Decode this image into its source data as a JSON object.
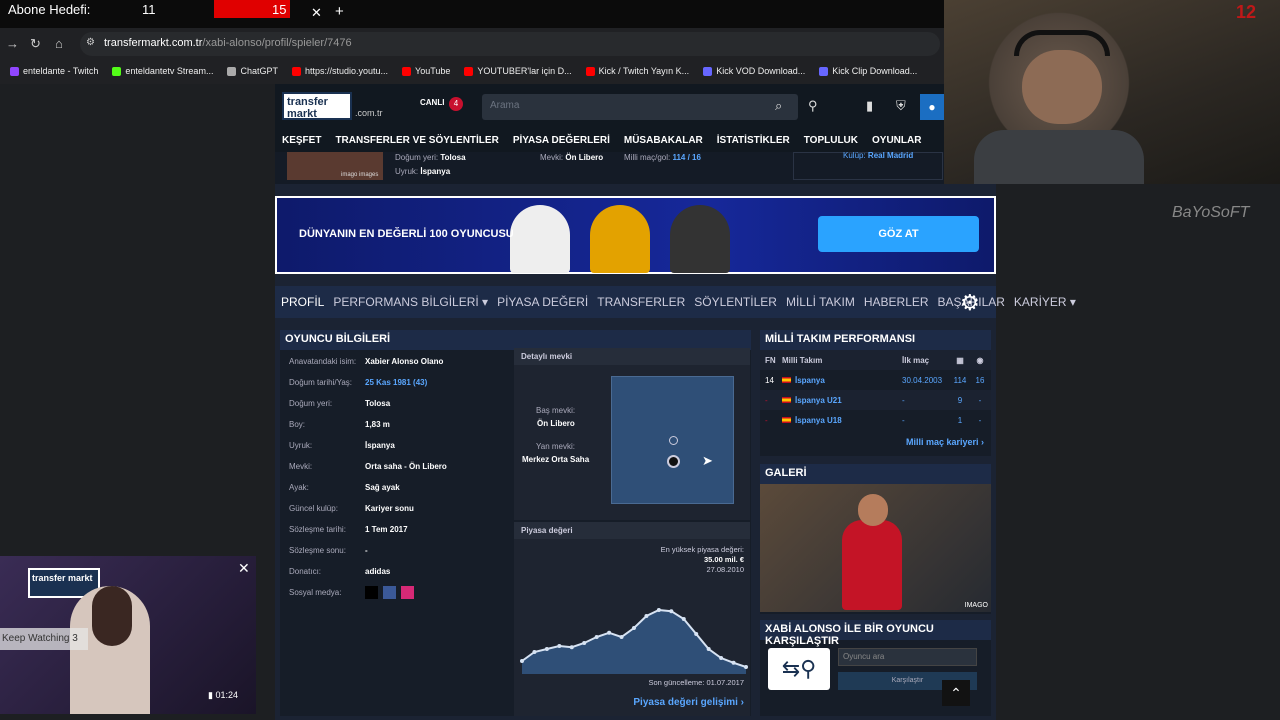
{
  "stream": {
    "goal_label": "Abone Hedefi:",
    "goal_value": "11",
    "goal_bar_value": "15",
    "webcam_counter": "12",
    "watermark": "BaYoSoFT"
  },
  "browser": {
    "url_host": "transfermarkt.com.tr",
    "url_path": "/xabi-alonso/profil/spieler/7476",
    "bookmarks": [
      {
        "label": "enteldante - Twitch",
        "color": "#9146ff"
      },
      {
        "label": "enteldantetv Stream...",
        "color": "#53fc18"
      },
      {
        "label": "ChatGPT",
        "color": "#aaaaaa"
      },
      {
        "label": "https://studio.youtu...",
        "color": "#ff0000"
      },
      {
        "label": "YouTube",
        "color": "#ff0000"
      },
      {
        "label": "YOUTUBER'lar için D...",
        "color": "#ff0000"
      },
      {
        "label": "Kick / Twitch Yayın K...",
        "color": "#ff0000"
      },
      {
        "label": "Kick VOD Download...",
        "color": "#6666ff"
      },
      {
        "label": "Kick Clip Download...",
        "color": "#6666ff"
      }
    ]
  },
  "site": {
    "logo": "transfer markt",
    "tld": ".com.tr",
    "live_label": "CANLI",
    "live_count": "4",
    "search_placeholder": "Arama",
    "main_nav": [
      "KEŞFET",
      "TRANSFERLER VE SÖYLENTİLER",
      "PİYASA DEĞERLERİ",
      "MÜSABAKALAR",
      "İSTATİSTİKLER",
      "TOPLULUK",
      "OYUNLAR"
    ],
    "strip": {
      "birthplace_label": "Doğum yeri:",
      "birthplace": "Tolosa",
      "citizenship_label": "Uyruk:",
      "citizenship": "İspanya",
      "position_label": "Mevki:",
      "position": "Ön Libero",
      "caps_label": "Milli maç/gol:",
      "caps": "114 / 16",
      "club_label": "Kulüp:",
      "club": "Real Madrid",
      "image_credit": "imago images"
    },
    "banner": {
      "text": "DÜNYANIN EN DEĞERLİ 100 OYUNCUSU",
      "button": "GÖZ AT"
    },
    "sub_nav": [
      "PROFİL",
      "PERFORMANS BİLGİLERİ ▾",
      "PİYASA DEĞERİ",
      "TRANSFERLER",
      "SÖYLENTİLER",
      "MİLLİ TAKIM",
      "HABERLER",
      "BAŞARILAR",
      "KARİYER ▾"
    ],
    "player_info": {
      "title": "OYUNCU BİLGİLERİ",
      "rows": [
        {
          "k": "Anavatandaki isim:",
          "v": "Xabier Alonso Olano"
        },
        {
          "k": "Doğum tarihi/Yaş:",
          "v": "25 Kas 1981 (43)"
        },
        {
          "k": "Doğum yeri:",
          "v": "Tolosa"
        },
        {
          "k": "Boy:",
          "v": "1,83 m"
        },
        {
          "k": "Uyruk:",
          "v": "İspanya"
        },
        {
          "k": "Mevki:",
          "v": "Orta saha - Ön Libero"
        },
        {
          "k": "Ayak:",
          "v": "Sağ ayak"
        },
        {
          "k": "Güncel kulüp:",
          "v": "Kariyer sonu"
        },
        {
          "k": "Sözleşme tarihi:",
          "v": "1 Tem 2017"
        },
        {
          "k": "Sözleşme sonu:",
          "v": "-"
        },
        {
          "k": "Donatıcı:",
          "v": "adidas"
        },
        {
          "k": "Sosyal medya:",
          "v": ""
        }
      ]
    },
    "position": {
      "title": "Detaylı mevki",
      "main_label": "Baş mevki:",
      "main": "Ön Libero",
      "side_label": "Yan mevki:",
      "side": "Merkez Orta Saha"
    },
    "market": {
      "title": "Piyasa değeri",
      "max_label": "En yüksek piyasa değeri:",
      "max_value": "35.00 mil. €",
      "max_date": "27.08.2010",
      "updated": "Son güncelleme: 01.07.2017",
      "link": "Piyasa değeri gelişimi"
    },
    "national": {
      "title": "MİLLİ TAKIM PERFORMANSI",
      "headers": [
        "FN",
        "Milli Takım",
        "İlk maç"
      ],
      "rows": [
        {
          "fn": "14",
          "team": "İspanya",
          "first": "30.04.2003",
          "apps": "114",
          "goals": "16"
        },
        {
          "fn": "-",
          "team": "İspanya U21",
          "first": "-",
          "apps": "9",
          "goals": "-"
        },
        {
          "fn": "-",
          "team": "İspanya U18",
          "first": "-",
          "apps": "1",
          "goals": "-"
        }
      ],
      "link": "Milli maç kariyeri"
    },
    "gallery": {
      "title": "GALERİ",
      "credit": "IMAGO"
    },
    "compare": {
      "title": "XABİ ALONSO İLE BİR OYUNCU KARŞILAŞTIR",
      "placeholder": "Oyuncu ara",
      "button": "Karşılaştır"
    }
  },
  "video": {
    "keep_watching": "Keep Watching 3",
    "time": "01:24"
  },
  "chart_data": {
    "type": "area",
    "title": "",
    "points": [
      0.15,
      0.3,
      0.35,
      0.4,
      0.38,
      0.45,
      0.55,
      0.62,
      0.55,
      0.7,
      0.9,
      1.0,
      0.98,
      0.85,
      0.6,
      0.35,
      0.2,
      0.12,
      0.05
    ]
  }
}
